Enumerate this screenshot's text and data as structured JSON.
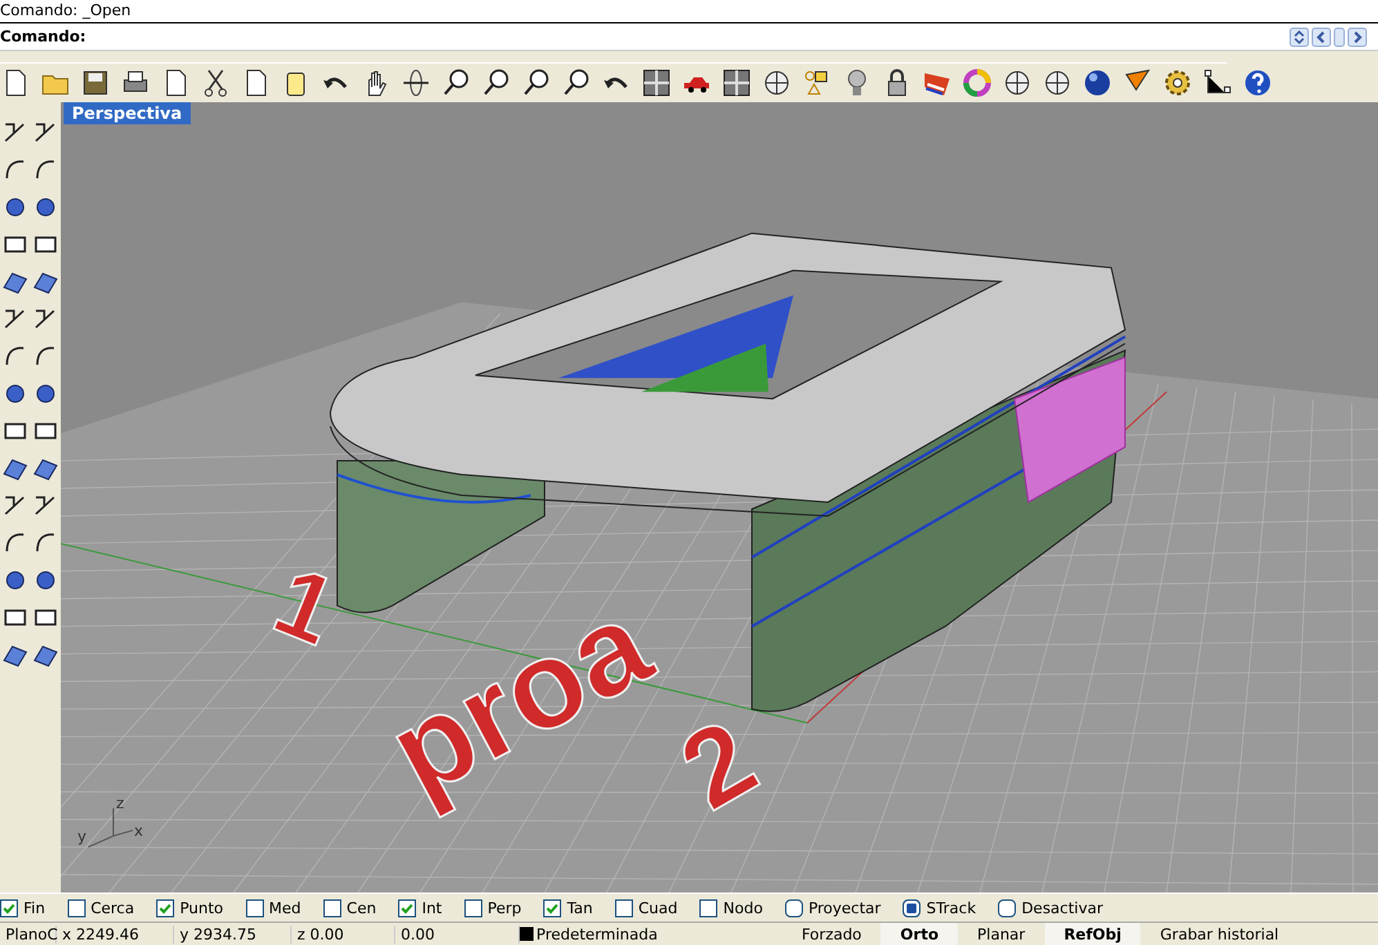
{
  "command_history": "Comando: _Open",
  "command_prompt": "Comando:",
  "viewport": {
    "title": "Perspectiva",
    "model_labels": [
      "1",
      "proa",
      "2"
    ],
    "axis_labels": [
      "z",
      "y",
      "x"
    ]
  },
  "osnaps": [
    {
      "label": "Fin",
      "kind": "square",
      "checked": true
    },
    {
      "label": "Cerca",
      "kind": "square",
      "checked": false
    },
    {
      "label": "Punto",
      "kind": "square",
      "checked": true
    },
    {
      "label": "Med",
      "kind": "square",
      "checked": false
    },
    {
      "label": "Cen",
      "kind": "square",
      "checked": false
    },
    {
      "label": "Int",
      "kind": "square",
      "checked": true
    },
    {
      "label": "Perp",
      "kind": "square",
      "checked": false
    },
    {
      "label": "Tan",
      "kind": "square",
      "checked": true
    },
    {
      "label": "Cuad",
      "kind": "square",
      "checked": false
    },
    {
      "label": "Nodo",
      "kind": "square",
      "checked": false
    },
    {
      "label": "Proyectar",
      "kind": "round",
      "checked": false
    },
    {
      "label": "STrack",
      "kind": "round",
      "checked": true
    },
    {
      "label": "Desactivar",
      "kind": "round",
      "checked": false
    }
  ],
  "status_bar": {
    "plane": "PlanoC",
    "x": "x 2249.46",
    "y": "y 2934.75",
    "z": "z 0.00",
    "distance": "0.00",
    "layer": "Predeterminada",
    "toggles": [
      {
        "label": "Forzado",
        "on": false
      },
      {
        "label": "Orto",
        "on": true
      },
      {
        "label": "Planar",
        "on": false
      },
      {
        "label": "RefObj",
        "on": true
      },
      {
        "label": "Grabar historial",
        "on": false
      }
    ]
  }
}
